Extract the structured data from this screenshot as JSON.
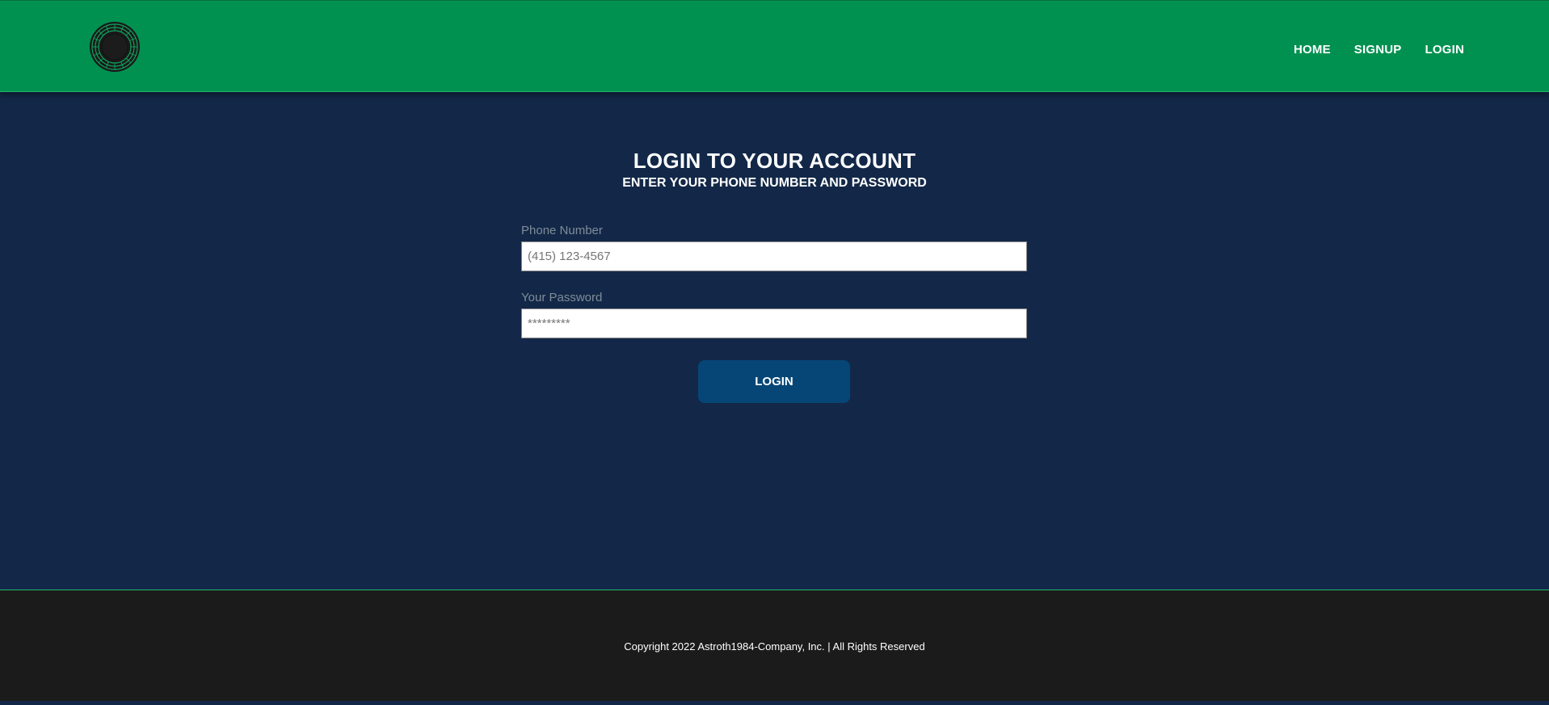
{
  "header": {
    "logo_icon": "circular-emblem-icon",
    "nav": [
      {
        "label": "HOME"
      },
      {
        "label": "SIGNUP"
      },
      {
        "label": "LOGIN"
      }
    ]
  },
  "main": {
    "title": "LOGIN TO YOUR ACCOUNT",
    "subtitle": "ENTER YOUR PHONE NUMBER AND PASSWORD",
    "phone": {
      "label": "Phone Number",
      "placeholder": "(415) 123-4567",
      "value": ""
    },
    "password": {
      "label": "Your Password",
      "placeholder": "*********",
      "value": ""
    },
    "login_button": "LOGIN"
  },
  "footer": {
    "copyright": "Copyright 2022 Astroth1984-Company, Inc. | All Rights Reserved"
  },
  "colors": {
    "header_bg": "#009150",
    "main_bg": "#132848",
    "button_bg": "#064677",
    "footer_bg": "#1b1b1b",
    "text": "#ffffff",
    "label_text": "#7f8c99"
  }
}
